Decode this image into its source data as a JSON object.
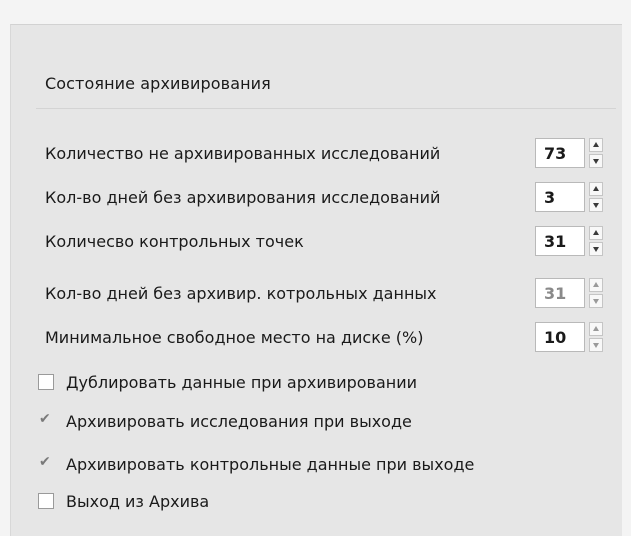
{
  "panel": {
    "title": "Состояние архивирования"
  },
  "spinners": [
    {
      "label": "Количество не архивированных исследований",
      "value": "73",
      "enabled": true
    },
    {
      "label": "Кол-во дней без архивирования исследований",
      "value": "3",
      "enabled": true
    },
    {
      "label": "Количесво контрольных точек",
      "value": "31",
      "enabled": true
    },
    {
      "label": "Кол-во дней без архивир. котрольных данных",
      "value": "31",
      "enabled": false
    },
    {
      "label": "Минимальное свободное место на диске (%)",
      "value": "10",
      "enabled": true
    }
  ],
  "checkboxes": [
    {
      "label": "Дублировать данные при архивировании",
      "checked": false
    },
    {
      "label": "Архивировать исследования при выходе",
      "checked": true
    },
    {
      "label": "Архивировать контрольные данные при выходе",
      "checked": true
    },
    {
      "label": "Выход из Архива",
      "checked": false
    }
  ],
  "icons": {
    "spin_up": "chevron-up-icon",
    "spin_down": "chevron-down-icon",
    "check": "checkmark-icon"
  },
  "colors": {
    "panel_bg": "#e6e6e6",
    "text": "#1a1a1a",
    "disabled_text": "#8a8a8a"
  }
}
